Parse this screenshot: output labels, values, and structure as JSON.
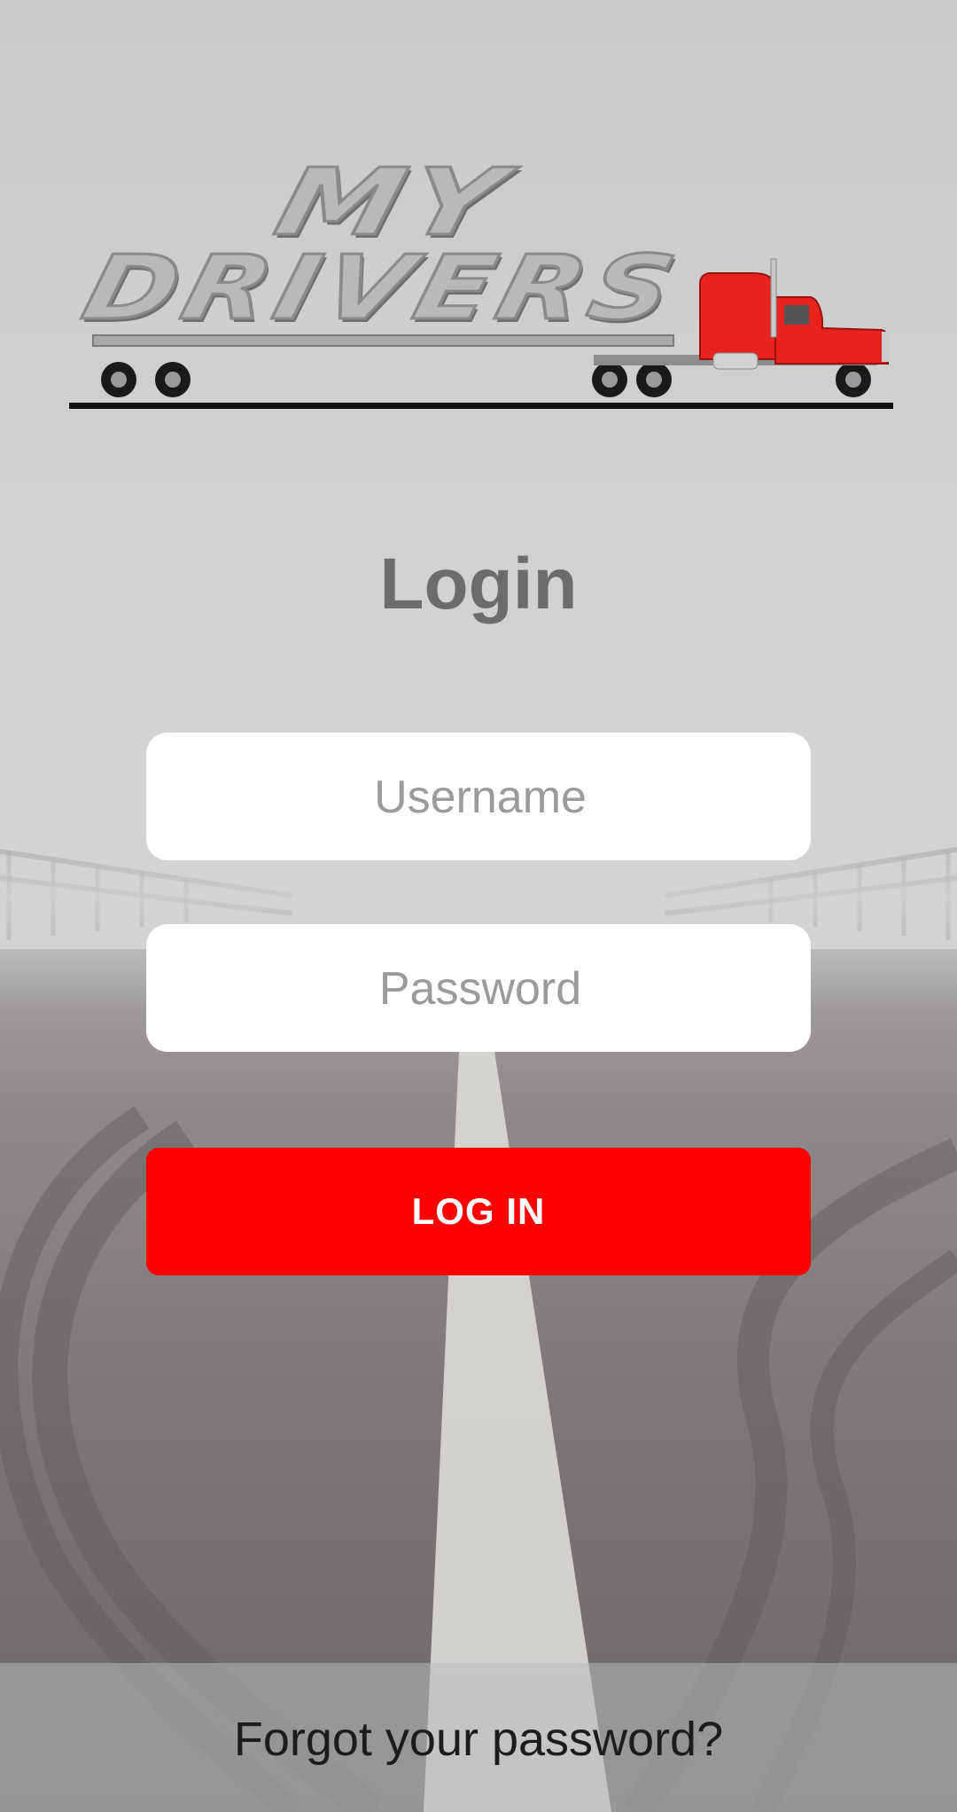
{
  "brand": {
    "logo_line1": "MY",
    "logo_line2": "DRIVERS",
    "truck_color": "#e8231e"
  },
  "login": {
    "title": "Login",
    "username_placeholder": "Username",
    "password_placeholder": "Password",
    "submit_label": "LOG IN",
    "forgot_label": "Forgot your password?"
  },
  "colors": {
    "accent": "#ff0000",
    "title": "#6c6c6c",
    "placeholder": "#9b9b9b",
    "field_bg": "#ffffff"
  }
}
